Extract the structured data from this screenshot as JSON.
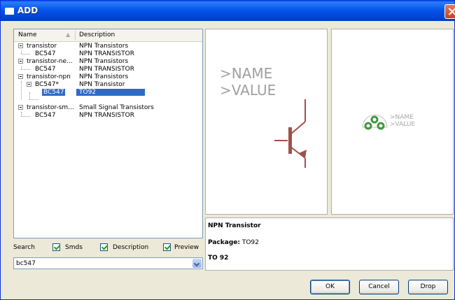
{
  "window": {
    "title": "ADD"
  },
  "tree": {
    "columns": {
      "name": "Name",
      "description": "Description"
    },
    "rows": [
      {
        "name": "transistor",
        "desc": "NPN Transistors"
      },
      {
        "name": "BC547",
        "desc": "NPN TRANSISTOR"
      },
      {
        "name": "transistor-ne...",
        "desc": "NPN Transistors"
      },
      {
        "name": "BC547",
        "desc": "NPN TRANSISTOR"
      },
      {
        "name": "transistor-npn",
        "desc": "NPN Transistors"
      },
      {
        "name": "BC547*",
        "desc": "NPN Transistor"
      },
      {
        "name": "BC547",
        "desc": "TO92"
      },
      {
        "name": "transistor-sm...",
        "desc": "Small Signal Transistors"
      },
      {
        "name": "BC547",
        "desc": "NPN TRANSISTOR"
      }
    ]
  },
  "options": {
    "search_label": "Search",
    "smds_label": "Smds",
    "description_label": "Description",
    "preview_label": "Preview",
    "smds_checked": true,
    "description_checked": true,
    "preview_checked": true
  },
  "search": {
    "value": "bc547"
  },
  "preview": {
    "symbol_name": ">NAME",
    "symbol_value": ">VALUE",
    "package_name": ">NAME",
    "package_value": ">VALUE",
    "symbol_color": "#a0504a",
    "package_color": "#3c9a3c"
  },
  "info": {
    "title": "NPN Transistor",
    "package_label": "Package:",
    "package_value": "TO92",
    "package_desc": "TO 92"
  },
  "buttons": {
    "ok": "OK",
    "cancel": "Cancel",
    "drop": "Drop"
  }
}
